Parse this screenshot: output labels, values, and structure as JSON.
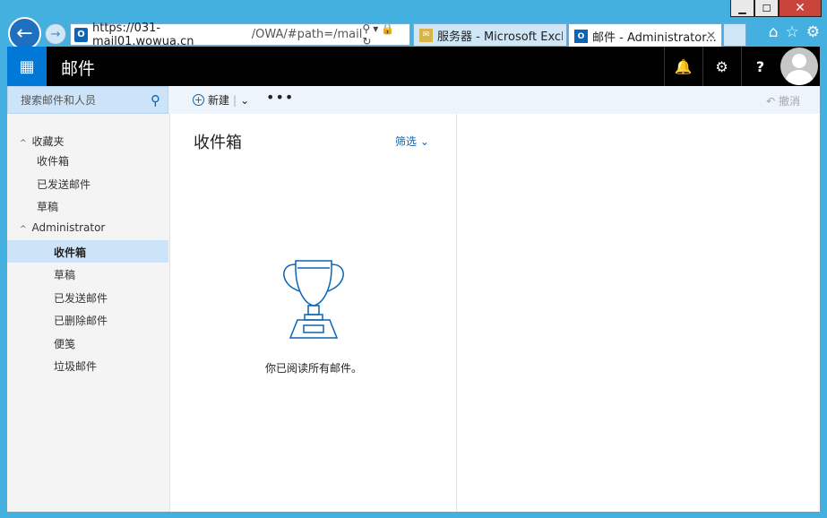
{
  "window": {
    "minimize": "▁",
    "maximize": "☐",
    "close": "✕"
  },
  "browser": {
    "url_host": "https://031-mail01.wowua.cn",
    "url_path": "/OWA/#path=/mail",
    "tabs": [
      {
        "label": "服务器 - Microsoft Exch...",
        "icon": "exchange-admin-icon"
      },
      {
        "label": "邮件 - Administrator...",
        "icon": "outlook-icon"
      }
    ],
    "tab_close": "✕"
  },
  "suite": {
    "app_title": "邮件"
  },
  "command_bar": {
    "search_placeholder": "搜索邮件和人员",
    "new_label": "新建",
    "more": "•••",
    "undo_label": "撤消"
  },
  "folders": {
    "favorites_label": "收藏夹",
    "favorites": [
      "收件箱",
      "已发送邮件",
      "草稿"
    ],
    "account_label": "Administrator",
    "account_folders": [
      "收件箱",
      "草稿",
      "已发送邮件",
      "已删除邮件",
      "便笺",
      "垃圾邮件"
    ],
    "selected": "收件箱"
  },
  "message_list": {
    "title": "收件箱",
    "filter_label": "筛选",
    "empty_text": "你已阅读所有邮件。"
  },
  "colors": {
    "accent": "#0078d7",
    "chrome": "#43b0e0",
    "selected_bg": "#cde3f7"
  }
}
